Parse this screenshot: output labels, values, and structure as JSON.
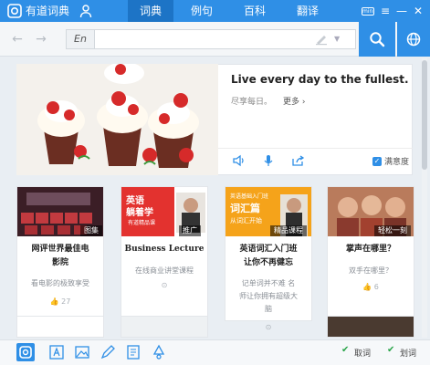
{
  "app": {
    "name": "有道词典"
  },
  "tabs": [
    {
      "label": "词典",
      "active": true
    },
    {
      "label": "例句",
      "active": false
    },
    {
      "label": "百科",
      "active": false
    },
    {
      "label": "翻译",
      "active": false
    }
  ],
  "window": {
    "mini_label": "mini",
    "menu": "≡",
    "minimize": "—",
    "maximize": "□",
    "close": "✕"
  },
  "search": {
    "lang": "En",
    "value": "",
    "placeholder": ""
  },
  "banner": {
    "quote": "Live every day to the fullest.",
    "subtitle": "尽享每日。",
    "more": "更多 ›",
    "satisfaction": "满意度"
  },
  "cards": [
    {
      "title_lines": [
        "网评世界最佳电",
        "影院"
      ],
      "desc_lines": [
        "看电影的极致享受"
      ],
      "tag": "图集",
      "likes": "27",
      "meta_type": "likes"
    },
    {
      "title_lines": [
        "Business Lecture"
      ],
      "desc_lines": [
        "在线商业讲堂课程"
      ],
      "tag": "推广",
      "thumb_text1": "英语",
      "thumb_text2": "躺着学",
      "thumb_text3": "有道精品课",
      "meta_type": "dot"
    },
    {
      "title_lines": [
        "英语词汇入门班",
        "让你不再健忘"
      ],
      "desc_lines": [
        "记单词并不难 名",
        "师让你拥有超级大",
        "脑"
      ],
      "tag": "精品课程",
      "thumb_text1": "英语基础入门班",
      "thumb_text2": "词汇篇",
      "thumb_text3": "从词汇开始",
      "meta_type": "dot"
    },
    {
      "title_lines": [
        "掌声在哪里？"
      ],
      "desc_lines": [
        "双手在哪里？"
      ],
      "tag": "轻松一刻",
      "likes": "6",
      "meta_type": "likes"
    }
  ],
  "statusbar": {
    "word_pick": "取词",
    "select_translate": "划词"
  },
  "colors": {
    "accent": "#2f8fe6",
    "red": "#e3322f",
    "orange": "#f5a31a",
    "green": "#2aa54a"
  }
}
